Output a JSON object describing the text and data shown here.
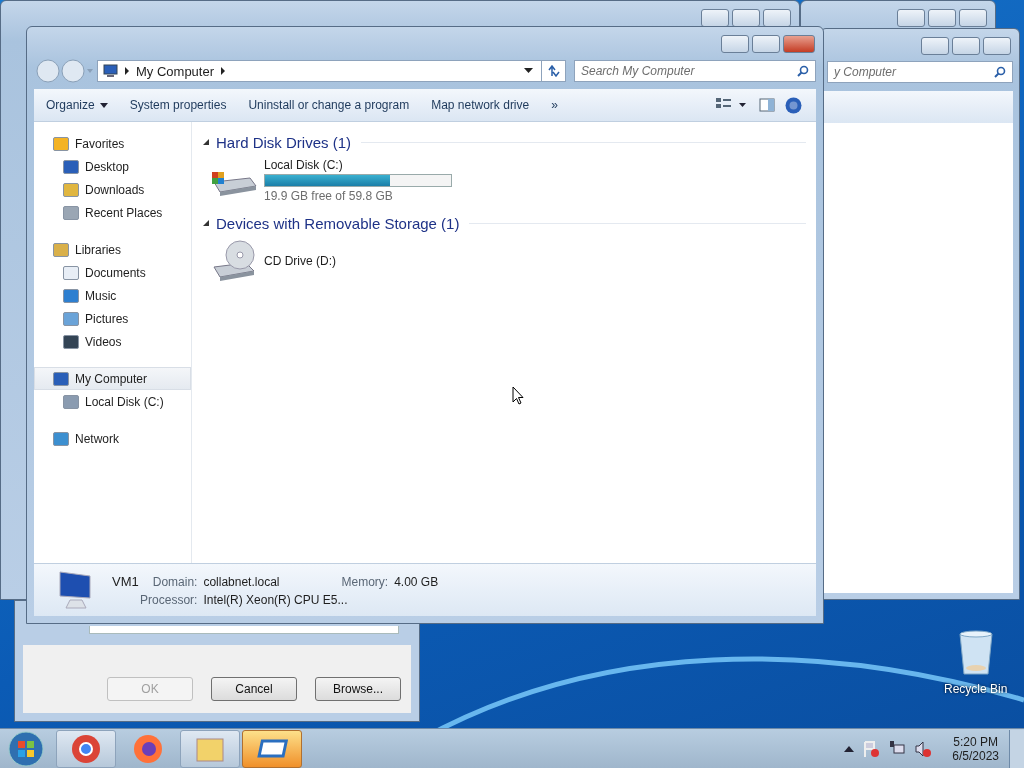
{
  "desktop": {
    "icons": [
      {
        "label": "Recycle Bin"
      }
    ]
  },
  "back_explorer": {
    "search": {
      "placeholder": "y Computer"
    }
  },
  "run_dialog": {
    "buttons": [
      {
        "label": "OK",
        "disabled": true
      },
      {
        "label": "Cancel",
        "disabled": false
      },
      {
        "label": "Browse...",
        "disabled": false
      }
    ]
  },
  "explorer": {
    "breadcrumb": [
      "My Computer"
    ],
    "search": {
      "placeholder": "Search My Computer"
    },
    "toolbar": [
      {
        "label": "Organize",
        "dropdown": true
      },
      {
        "label": "System properties",
        "dropdown": false
      },
      {
        "label": "Uninstall or change a program",
        "dropdown": false
      },
      {
        "label": "Map network drive",
        "dropdown": false
      },
      {
        "label": "»",
        "dropdown": false
      }
    ],
    "nav": [
      {
        "label": "Favorites",
        "selected": false,
        "children": [
          {
            "label": "Desktop",
            "selected": false
          },
          {
            "label": "Downloads",
            "selected": false
          },
          {
            "label": "Recent Places",
            "selected": false
          }
        ]
      },
      {
        "label": "Libraries",
        "selected": false,
        "children": [
          {
            "label": "Documents",
            "selected": false
          },
          {
            "label": "Music",
            "selected": false
          },
          {
            "label": "Pictures",
            "selected": false
          },
          {
            "label": "Videos",
            "selected": false
          }
        ]
      },
      {
        "label": "My Computer",
        "selected": true,
        "children": [
          {
            "label": "Local Disk (C:)",
            "selected": false
          }
        ]
      },
      {
        "label": "Network",
        "selected": false
      }
    ],
    "groups": [
      {
        "title": "Hard Disk Drives (1)",
        "expanded": true,
        "items": [
          {
            "kind": "disk",
            "name": "Local Disk (C:)",
            "level": 0.67,
            "caption": "19.9 GB free of 59.8 GB"
          }
        ]
      },
      {
        "title": "Devices with Removable Storage (1)",
        "expanded": true,
        "items": [
          {
            "kind": "cd",
            "name": "CD Drive (D:)"
          }
        ]
      }
    ],
    "details": {
      "name": "VM1",
      "fields": [
        {
          "label": "Domain:",
          "value": "collabnet.local"
        },
        {
          "label": "Memory:",
          "value": "4.00 GB"
        },
        {
          "label": "Processor:",
          "value": "Intel(R) Xeon(R) CPU E5..."
        }
      ]
    }
  },
  "taskbar": {
    "apps": [
      {
        "kind": "chrome",
        "running": true,
        "selected": false
      },
      {
        "kind": "firefox",
        "running": false,
        "selected": false
      },
      {
        "kind": "explorer",
        "running": true,
        "selected": false
      },
      {
        "kind": "remote",
        "running": true,
        "selected": true
      }
    ],
    "clock": {
      "time": "5:20 PM",
      "date": "6/5/2023"
    }
  }
}
